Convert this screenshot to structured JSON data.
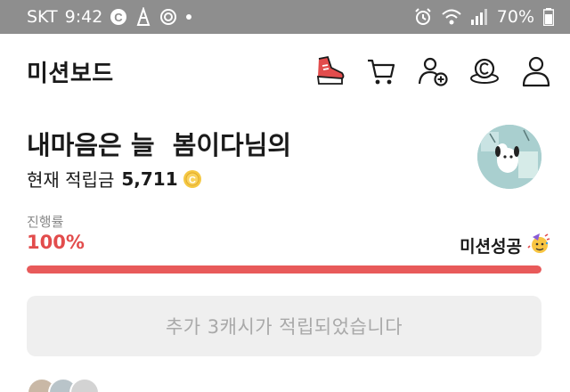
{
  "status_bar": {
    "carrier": "SKT",
    "time": "9:42",
    "battery": "70%"
  },
  "header": {
    "title": "미션보드",
    "icons": [
      "shoe-icon",
      "cart-icon",
      "add-friend-icon",
      "coin-icon",
      "profile-icon"
    ]
  },
  "user": {
    "name": "내마음은 늘  봄이다님의",
    "balance_label": "현재 적립금",
    "balance_value": "5,711"
  },
  "progress": {
    "label": "진행률",
    "value_text": "100%",
    "fraction": 1.0,
    "status_text": "미션성공"
  },
  "notice": {
    "text": "추가 3캐시가 적립되었습니다"
  },
  "colors": {
    "accent": "#e24c4c",
    "status_bar": "#8e8e8e",
    "notice_bg": "#efefef"
  }
}
